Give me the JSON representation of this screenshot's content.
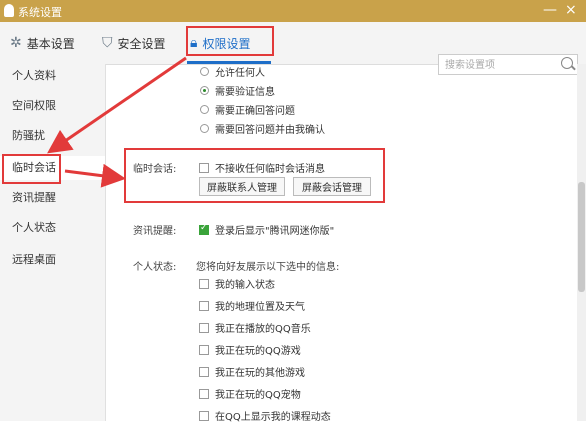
{
  "window": {
    "title": "系统设置",
    "min": "—",
    "close": "×"
  },
  "tabs": {
    "basic": "基本设置",
    "security": "安全设置",
    "permission": "权限设置"
  },
  "search": {
    "placeholder": "搜索设置项"
  },
  "sidebar": {
    "items": [
      {
        "label": "个人资料"
      },
      {
        "label": "空间权限"
      },
      {
        "label": "防骚扰"
      },
      {
        "label": "临时会话"
      },
      {
        "label": "资讯提醒"
      },
      {
        "label": "个人状态"
      },
      {
        "label": "远程桌面"
      }
    ]
  },
  "verification": {
    "options": [
      {
        "label": "允许任何人",
        "selected": false
      },
      {
        "label": "需要验证信息",
        "selected": true
      },
      {
        "label": "需要正确回答问题",
        "selected": false
      },
      {
        "label": "需要回答问题并由我确认",
        "selected": false
      }
    ]
  },
  "temp_session": {
    "label": "临时会话:",
    "checkbox_label": "不接收任何临时会话消息",
    "checked": false,
    "btn_block_contacts": "屏蔽联系人管理",
    "btn_block_sessions": "屏蔽会话管理"
  },
  "news": {
    "label": "资讯提醒:",
    "checkbox_label": "登录后显示\"腾讯网迷你版\"",
    "checked": true
  },
  "status": {
    "label": "个人状态:",
    "description": "您将向好友展示以下选中的信息:",
    "options": [
      {
        "label": "我的输入状态",
        "checked": false
      },
      {
        "label": "我的地理位置及天气",
        "checked": false
      },
      {
        "label": "我正在播放的QQ音乐",
        "checked": false
      },
      {
        "label": "我正在玩的QQ游戏",
        "checked": false
      },
      {
        "label": "我正在玩的其他游戏",
        "checked": false
      },
      {
        "label": "我正在玩的QQ宠物",
        "checked": false
      },
      {
        "label": "在QQ上显示我的课程动态",
        "checked": false
      }
    ]
  },
  "colors": {
    "accent": "#1e6ec8",
    "titlebar": "#c9a24a",
    "highlight": "#e23a3a",
    "check": "#3aa33a"
  }
}
